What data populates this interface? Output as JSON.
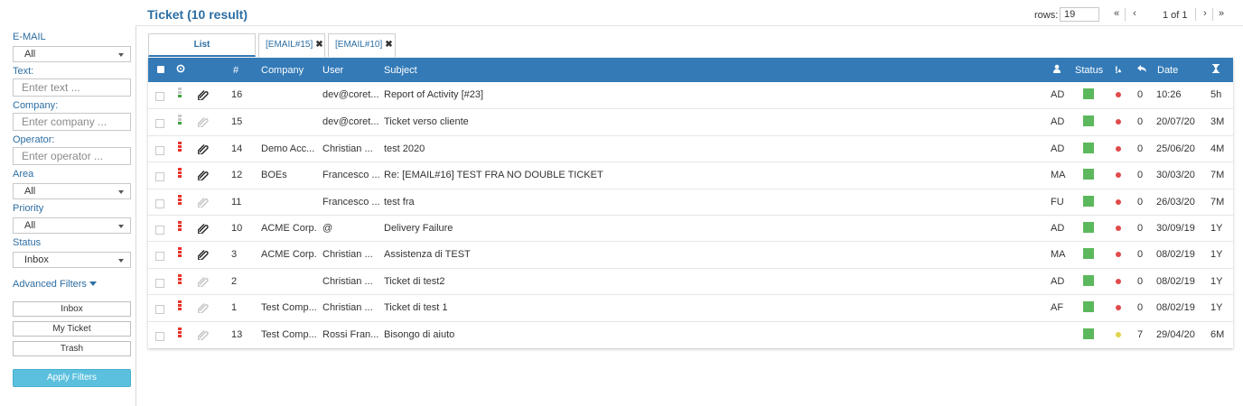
{
  "header": {
    "title": "Ticket (10 result)",
    "rows_label": "rows:",
    "rows_value": "19",
    "page_info": "1 of 1",
    "first_page": "«",
    "prev_page": "‹",
    "next_page": "›",
    "last_page": "»"
  },
  "sidebar": {
    "email_label": "E-MAIL",
    "email_value": "All",
    "text_label": "Text:",
    "text_placeholder": "Enter text ...",
    "company_label": "Company:",
    "company_placeholder": "Enter company ...",
    "operator_label": "Operator:",
    "operator_placeholder": "Enter operator ...",
    "area_label": "Area",
    "area_value": "All",
    "priority_label": "Priority",
    "priority_value": "All",
    "status_label": "Status",
    "status_value": "Inbox",
    "advanced_filters": "Advanced Filters",
    "inbox_button": "Inbox",
    "my_ticket_button": "My Ticket",
    "trash_button": "Trash",
    "apply_button": "Apply Filters"
  },
  "tabs": {
    "list": "List",
    "email15": "[EMAIL#15]",
    "email10": "[EMAIL#10]",
    "close_glyph": "✖"
  },
  "table": {
    "headers": {
      "num": "#",
      "company": "Company",
      "user": "User",
      "subject": "Subject",
      "status": "Status",
      "priority": "!",
      "date": "Date"
    },
    "rows": [
      {
        "num": "16",
        "company": "",
        "user": "dev@coret...",
        "subject": "Report of Activity [#23]",
        "assignee": "AD",
        "replies": "0",
        "date": "10:26",
        "age": "5h",
        "priority": "low",
        "attached": true,
        "dot": "red"
      },
      {
        "num": "15",
        "company": "",
        "user": "dev@coret...",
        "subject": "Ticket verso cliente",
        "assignee": "AD",
        "replies": "0",
        "date": "20/07/20",
        "age": "3M",
        "priority": "low",
        "attached": false,
        "dot": "red"
      },
      {
        "num": "14",
        "company": "Demo Acc...",
        "user": "Christian ...",
        "subject": "test 2020",
        "assignee": "AD",
        "replies": "0",
        "date": "25/06/20",
        "age": "4M",
        "priority": "high",
        "attached": true,
        "dot": "red"
      },
      {
        "num": "12",
        "company": "BOEs",
        "user": "Francesco ...",
        "subject": "Re: [EMAIL#16] TEST FRA NO DOUBLE TICKET",
        "assignee": "MA",
        "replies": "0",
        "date": "30/03/20",
        "age": "7M",
        "priority": "high",
        "attached": true,
        "dot": "red"
      },
      {
        "num": "11",
        "company": "",
        "user": "Francesco ...",
        "subject": "test fra",
        "assignee": "FU",
        "replies": "0",
        "date": "26/03/20",
        "age": "7M",
        "priority": "high",
        "attached": false,
        "dot": "red"
      },
      {
        "num": "10",
        "company": "ACME Corp.",
        "user": "@",
        "subject": "Delivery Failure",
        "assignee": "AD",
        "replies": "0",
        "date": "30/09/19",
        "age": "1Y",
        "priority": "high",
        "attached": true,
        "dot": "red"
      },
      {
        "num": "3",
        "company": "ACME Corp.",
        "user": "Christian ...",
        "subject": "Assistenza di TEST",
        "assignee": "MA",
        "replies": "0",
        "date": "08/02/19",
        "age": "1Y",
        "priority": "high",
        "attached": true,
        "dot": "red"
      },
      {
        "num": "2",
        "company": "",
        "user": "Christian ...",
        "subject": "Ticket di test2",
        "assignee": "AD",
        "replies": "0",
        "date": "08/02/19",
        "age": "1Y",
        "priority": "high",
        "attached": false,
        "dot": "red"
      },
      {
        "num": "1",
        "company": "Test Comp...",
        "user": "Christian ...",
        "subject": "Ticket di test 1",
        "assignee": "AF",
        "replies": "0",
        "date": "08/02/19",
        "age": "1Y",
        "priority": "high",
        "attached": false,
        "dot": "red"
      },
      {
        "num": "13",
        "company": "Test Comp...",
        "user": "Rossi Fran...",
        "subject": "Bisongo di aiuto",
        "assignee": "",
        "replies": "7",
        "date": "29/04/20",
        "age": "6M",
        "priority": "high",
        "attached": false,
        "dot": "yellow"
      }
    ]
  },
  "colors": {
    "accent": "#337ab7",
    "title": "#2c6ea3",
    "status_green": "#5cb85c",
    "priority_red": "#e8332a",
    "priority_low_gray": "#c8c8c8",
    "priority_low_green": "#3fa33f",
    "dot_red": "#e04a4a",
    "dot_yellow": "#e0d54a",
    "apply_button": "#5bc0de"
  },
  "icons": {
    "settings": "gear-icon",
    "assignee": "person-icon",
    "sort": "sort-asc-icon",
    "reply": "reply-icon",
    "age": "hourglass-icon",
    "attachment": "paperclip-icon"
  }
}
